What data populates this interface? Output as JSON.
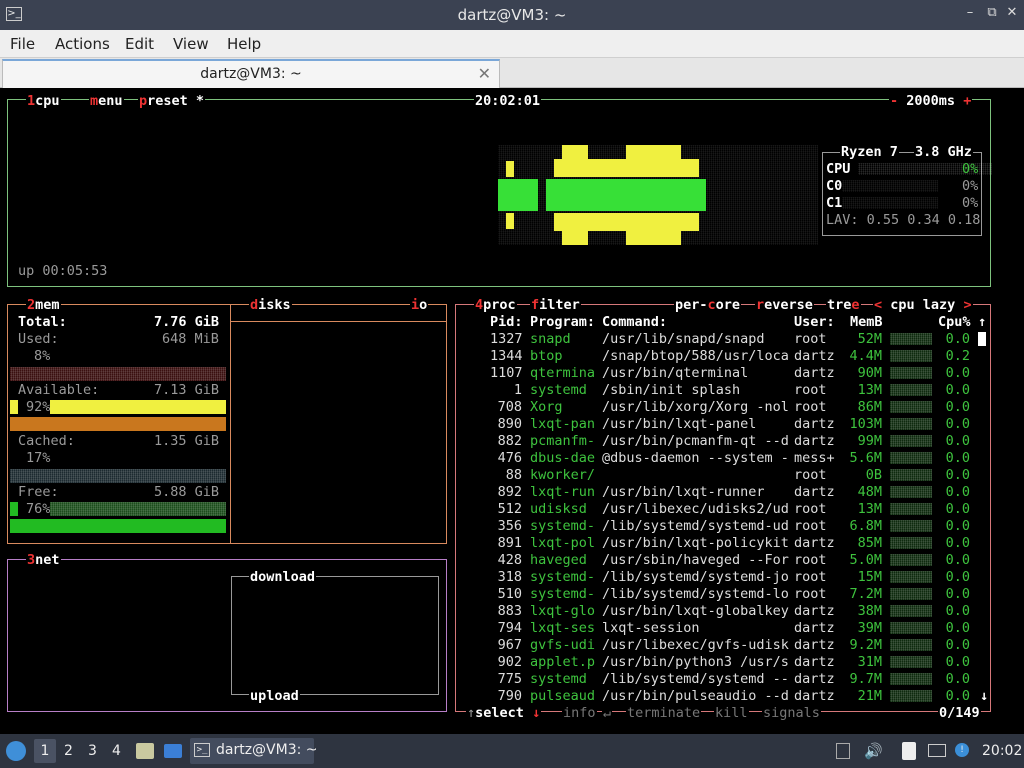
{
  "window": {
    "title": "dartz@VM3: ~",
    "tab_title": "dartz@VM3: ~"
  },
  "menu": [
    "File",
    "Actions",
    "Edit",
    "View",
    "Help"
  ],
  "btop": {
    "cpu_box": {
      "num": "1",
      "label": "cpu",
      "menu_first": "m",
      "menu_rest": "enu",
      "preset_first": "p",
      "preset_rest": "reset *",
      "clock": "20:02:01",
      "interval_minus": "-",
      "interval": "2000ms",
      "interval_plus": "+",
      "uptime": "up 00:05:53",
      "cpu_name": "Ryzen 7",
      "cpu_freq": "3.8 GHz",
      "cores": [
        {
          "label": "CPU",
          "pct": "0%"
        },
        {
          "label": "C0",
          "pct": "0%"
        },
        {
          "label": "C1",
          "pct": "0%"
        }
      ],
      "lav": "LAV: 0.55 0.34 0.18"
    },
    "mem_box": {
      "num": "2",
      "label": "mem",
      "total_label": "Total:",
      "total_val": "7.76 GiB",
      "used_label": "Used:",
      "used_val": "648 MiB",
      "used_pct": "8%",
      "avail_label": "Available:",
      "avail_val": "7.13 GiB",
      "avail_pct": "92%",
      "cached_label": "Cached:",
      "cached_val": "1.35 GiB",
      "cached_pct": "17%",
      "free_label": "Free:",
      "free_val": "5.88 GiB",
      "free_pct": "76%",
      "used_fill": 0.08,
      "avail_fill": 0.92,
      "cached_fill": 0.17,
      "free_fill": 0.76
    },
    "disks_box": {
      "first": "d",
      "rest": "isks",
      "io_first": "i",
      "io_rest": "o"
    },
    "net_box": {
      "num": "3",
      "label": "net",
      "download": "download",
      "upload": "upload"
    },
    "proc_box": {
      "num": "4",
      "label": "proc",
      "filter_first": "f",
      "filter_rest": "ilter",
      "percore_a": "per-",
      "percore_c": "c",
      "percore_b": "ore",
      "reverse_first": "r",
      "reverse_rest": "everse",
      "tree_a": "tre",
      "tree_e": "e",
      "sort_left": "<",
      "sort_name": "cpu lazy",
      "sort_right": ">",
      "headers": {
        "pid": "Pid:",
        "program": "Program:",
        "command": "Command:",
        "user": "User:",
        "mem": "MemB",
        "cpu": "Cpu%"
      },
      "rows": [
        {
          "pid": "1327",
          "program": "snapd",
          "command": "/usr/lib/snapd/snapd",
          "user": "root",
          "mem": "52M",
          "cpu": "0.0"
        },
        {
          "pid": "1344",
          "program": "btop",
          "command": "/snap/btop/588/usr/loca",
          "user": "dartz",
          "mem": "4.4M",
          "cpu": "0.2"
        },
        {
          "pid": "1107",
          "program": "qtermina",
          "command": "/usr/bin/qterminal",
          "user": "dartz",
          "mem": "90M",
          "cpu": "0.0"
        },
        {
          "pid": "1",
          "program": "systemd",
          "command": "/sbin/init splash",
          "user": "root",
          "mem": "13M",
          "cpu": "0.0"
        },
        {
          "pid": "708",
          "program": "Xorg",
          "command": "/usr/lib/xorg/Xorg -nol",
          "user": "root",
          "mem": "86M",
          "cpu": "0.0"
        },
        {
          "pid": "890",
          "program": "lxqt-pan",
          "command": "/usr/bin/lxqt-panel",
          "user": "dartz",
          "mem": "103M",
          "cpu": "0.0"
        },
        {
          "pid": "882",
          "program": "pcmanfm-",
          "command": "/usr/bin/pcmanfm-qt --d",
          "user": "dartz",
          "mem": "99M",
          "cpu": "0.0"
        },
        {
          "pid": "476",
          "program": "dbus-dae",
          "command": "@dbus-daemon --system -",
          "user": "mess+",
          "mem": "5.6M",
          "cpu": "0.0"
        },
        {
          "pid": "88",
          "program": "kworker/",
          "command": "",
          "user": "root",
          "mem": "0B",
          "cpu": "0.0"
        },
        {
          "pid": "892",
          "program": "lxqt-run",
          "command": "/usr/bin/lxqt-runner",
          "user": "dartz",
          "mem": "48M",
          "cpu": "0.0"
        },
        {
          "pid": "512",
          "program": "udisksd",
          "command": "/usr/libexec/udisks2/ud",
          "user": "root",
          "mem": "13M",
          "cpu": "0.0"
        },
        {
          "pid": "356",
          "program": "systemd-",
          "command": "/lib/systemd/systemd-ud",
          "user": "root",
          "mem": "6.8M",
          "cpu": "0.0"
        },
        {
          "pid": "891",
          "program": "lxqt-pol",
          "command": "/usr/bin/lxqt-policykit",
          "user": "dartz",
          "mem": "85M",
          "cpu": "0.0"
        },
        {
          "pid": "428",
          "program": "haveged",
          "command": "/usr/sbin/haveged --For",
          "user": "root",
          "mem": "5.0M",
          "cpu": "0.0"
        },
        {
          "pid": "318",
          "program": "systemd-",
          "command": "/lib/systemd/systemd-jo",
          "user": "root",
          "mem": "15M",
          "cpu": "0.0"
        },
        {
          "pid": "510",
          "program": "systemd-",
          "command": "/lib/systemd/systemd-lo",
          "user": "root",
          "mem": "7.2M",
          "cpu": "0.0"
        },
        {
          "pid": "883",
          "program": "lxqt-glo",
          "command": "/usr/bin/lxqt-globalkey",
          "user": "dartz",
          "mem": "38M",
          "cpu": "0.0"
        },
        {
          "pid": "794",
          "program": "lxqt-ses",
          "command": "lxqt-session",
          "user": "dartz",
          "mem": "39M",
          "cpu": "0.0"
        },
        {
          "pid": "967",
          "program": "gvfs-udi",
          "command": "/usr/libexec/gvfs-udisk",
          "user": "dartz",
          "mem": "9.2M",
          "cpu": "0.0"
        },
        {
          "pid": "902",
          "program": "applet.p",
          "command": "/usr/bin/python3 /usr/s",
          "user": "dartz",
          "mem": "31M",
          "cpu": "0.0"
        },
        {
          "pid": "775",
          "program": "systemd",
          "command": "/lib/systemd/systemd --",
          "user": "dartz",
          "mem": "9.7M",
          "cpu": "0.0"
        },
        {
          "pid": "790",
          "program": "pulseaud",
          "command": "/usr/bin/pulseaudio --d",
          "user": "dartz",
          "mem": "21M",
          "cpu": "0.0"
        }
      ],
      "footer": {
        "select": "select",
        "info": "info",
        "terminate": "terminate",
        "kill": "kill",
        "signals": "signals",
        "count": "0/149",
        "up_arrow": "↑",
        "down_arrow": "↓",
        "enter_arrow": "↵",
        "scroll_up": "↑",
        "scroll_down": "↓"
      }
    }
  },
  "taskbar": {
    "workspaces": [
      "1",
      "2",
      "3",
      "4"
    ],
    "task_label": "dartz@VM3: ~",
    "clock": "20:02"
  },
  "colors": {
    "cpu_box": "#7ec27e",
    "mem_box": "#d98a5e",
    "net_box": "#b77fc7",
    "proc_box": "#d6787a",
    "bar_green": "#22dd22",
    "bar_yellow": "#f0f040",
    "bar_orange": "#c9771e"
  }
}
